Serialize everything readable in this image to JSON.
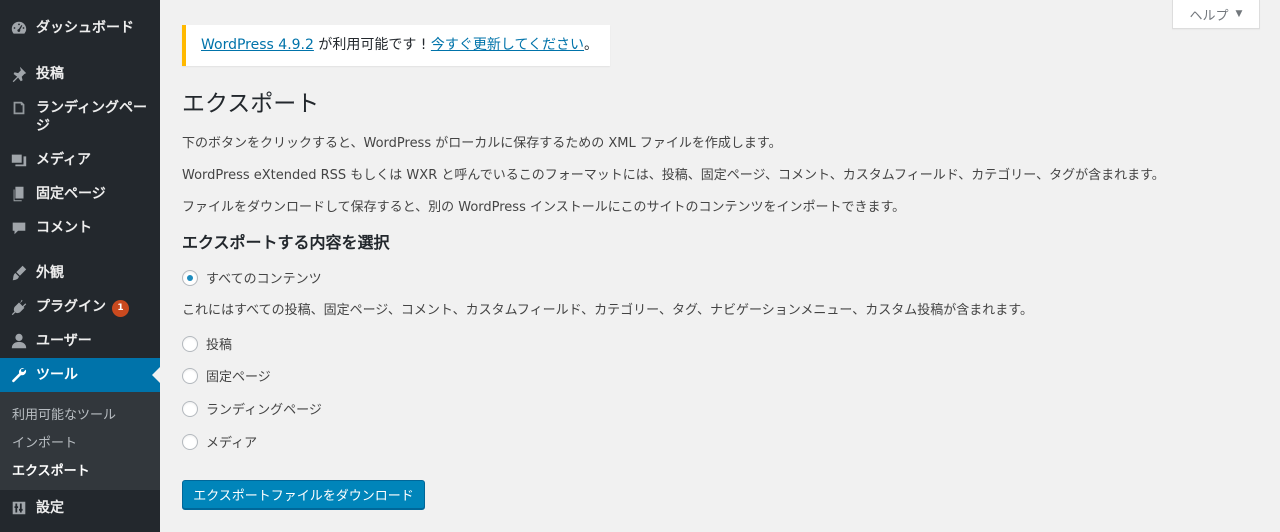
{
  "sidebar": {
    "items": [
      {
        "key": "dashboard",
        "label": "ダッシュボード",
        "icon": "dashboard-icon"
      },
      {
        "key": "posts",
        "label": "投稿",
        "icon": "pin-icon"
      },
      {
        "key": "landing",
        "label": "ランディングページ",
        "icon": "book-icon"
      },
      {
        "key": "media",
        "label": "メディア",
        "icon": "media-icon"
      },
      {
        "key": "pages",
        "label": "固定ページ",
        "icon": "page-icon"
      },
      {
        "key": "comments",
        "label": "コメント",
        "icon": "comment-icon"
      },
      {
        "key": "appearance",
        "label": "外観",
        "icon": "brush-icon"
      },
      {
        "key": "plugins",
        "label": "プラグイン",
        "icon": "plugin-icon",
        "badge": "1"
      },
      {
        "key": "users",
        "label": "ユーザー",
        "icon": "user-icon"
      },
      {
        "key": "tools",
        "label": "ツール",
        "icon": "wrench-icon",
        "current": true
      },
      {
        "key": "settings",
        "label": "設定",
        "icon": "settings-icon"
      }
    ],
    "submenu": [
      {
        "label": "利用可能なツール"
      },
      {
        "label": "インポート"
      },
      {
        "label": "エクスポート",
        "current": true
      }
    ]
  },
  "help_tab": {
    "label": "ヘルプ",
    "caret": "▼"
  },
  "notice": {
    "version_link": "WordPress 4.9.2",
    "middle_text": " が利用可能です ! ",
    "update_link": "今すぐ更新してください",
    "end_text": "。"
  },
  "page": {
    "title": "エクスポート",
    "desc1": "下のボタンをクリックすると、WordPress がローカルに保存するための XML ファイルを作成します。",
    "desc2": "WordPress eXtended RSS もしくは WXR と呼んでいるこのフォーマットには、投稿、固定ページ、コメント、カスタムフィールド、カテゴリー、タグが含まれます。",
    "desc3": "ファイルをダウンロードして保存すると、別の WordPress インストールにこのサイトのコンテンツをインポートできます。",
    "section_heading": "エクスポートする内容を選択",
    "options": [
      {
        "label": "すべてのコンテンツ",
        "checked": true
      },
      {
        "label": "投稿",
        "checked": false
      },
      {
        "label": "固定ページ",
        "checked": false
      },
      {
        "label": "ランディングページ",
        "checked": false
      },
      {
        "label": "メディア",
        "checked": false
      }
    ],
    "all_content_note": "これにはすべての投稿、固定ページ、コメント、カスタムフィールド、カテゴリー、タグ、ナビゲーションメニュー、カスタム投稿が含まれます。",
    "download_button": "エクスポートファイルをダウンロード"
  },
  "colors": {
    "sidebar_bg": "#23282d",
    "submenu_bg": "#32373c",
    "accent": "#0073aa",
    "button": "#0085ba",
    "notice_border": "#ffb900",
    "badge": "#ca4a1f"
  }
}
